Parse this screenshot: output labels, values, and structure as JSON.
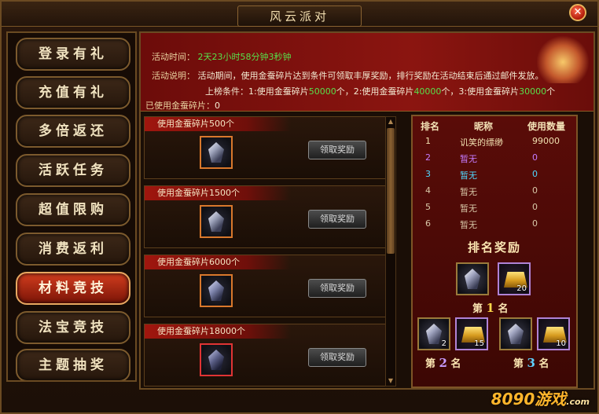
{
  "window": {
    "title": "风云派对",
    "close_label": "✕"
  },
  "menu": {
    "items": [
      {
        "label": "登录有礼",
        "active": false
      },
      {
        "label": "充值有礼",
        "active": false
      },
      {
        "label": "多倍返还",
        "active": false
      },
      {
        "label": "活跃任务",
        "active": false
      },
      {
        "label": "超值限购",
        "active": false
      },
      {
        "label": "消费返利",
        "active": false
      },
      {
        "label": "材料竞技",
        "active": true
      },
      {
        "label": "法宝竞技",
        "active": false
      },
      {
        "label": "主题抽奖",
        "active": false
      }
    ]
  },
  "event": {
    "time_label": "活动时间：",
    "time_value": "2天23小时58分钟3秒钟",
    "desc_label": "活动说明：",
    "desc_value": "活动期间，使用金蚕碎片达到条件可领取丰厚奖励，排行奖励在活动结束后通过邮件发放。",
    "cond_prefix": "上榜条件：1:使用金蚕碎片",
    "cond_1": "50000",
    "cond_mid1": "个，2:使用金蚕碎片",
    "cond_2": "40000",
    "cond_mid2": "个，3:使用金蚕碎片",
    "cond_3": "30000",
    "cond_suffix": "个",
    "used_label": "已使用金蚕碎片：",
    "used_value": "0"
  },
  "rewards": [
    {
      "title": "使用金蚕碎片500个",
      "button": "领取奖励",
      "icon": "crystal-gem-icon"
    },
    {
      "title": "使用金蚕碎片1500个",
      "button": "领取奖励",
      "icon": "crystal-gem-icon"
    },
    {
      "title": "使用金蚕碎片6000个",
      "button": "领取奖励",
      "icon": "crystal-gem-icon"
    },
    {
      "title": "使用金蚕碎片18000个",
      "button": "领取奖励",
      "icon": "crystal-gem-icon"
    }
  ],
  "ranking": {
    "headers": {
      "rank": "排名",
      "name": "昵称",
      "amount": "使用数量"
    },
    "rows": [
      {
        "rank": "1",
        "name": "讥笑的缥缈",
        "amount": "99000",
        "color": "#f0e0b0"
      },
      {
        "rank": "2",
        "name": "暂无",
        "amount": "0",
        "color": "#c47cff"
      },
      {
        "rank": "3",
        "name": "暂无",
        "amount": "0",
        "color": "#4fd8ff"
      },
      {
        "rank": "4",
        "name": "暂无",
        "amount": "0",
        "color": "#d8c8a8"
      },
      {
        "rank": "5",
        "name": "暂无",
        "amount": "0",
        "color": "#d8c8a8"
      },
      {
        "rank": "6",
        "name": "暂无",
        "amount": "0",
        "color": "#d8c8a8"
      }
    ],
    "reward_title": "排名奖励",
    "first": {
      "pre": "第",
      "num": "1",
      "post": "名",
      "gem_count": "",
      "gold_count": "20"
    },
    "second": {
      "pre": "第",
      "num": "2",
      "post": "名",
      "gem_count": "2",
      "gold_count": "15"
    },
    "third": {
      "pre": "第",
      "num": "3",
      "post": "名",
      "gem_count": "",
      "gold_count": "10"
    }
  },
  "watermark": {
    "brand": "8090",
    "suffix": "游戏",
    "domain": ".com"
  }
}
